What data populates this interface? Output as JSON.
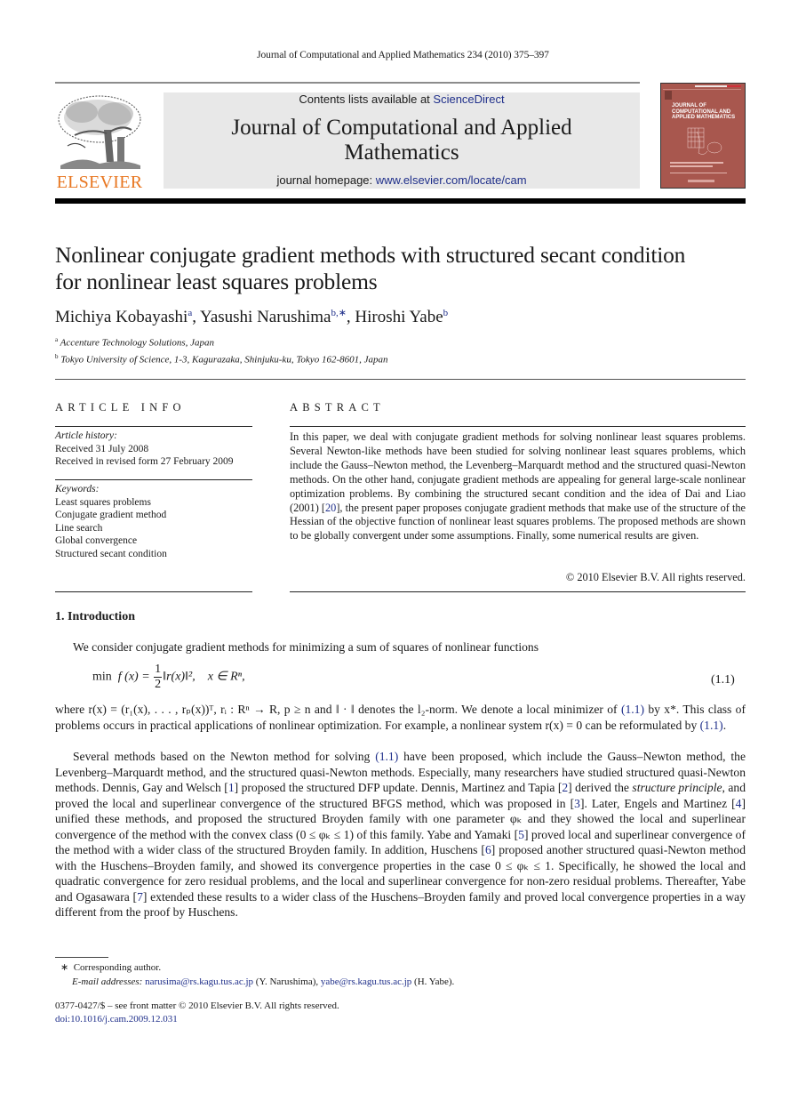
{
  "running_head": "Journal of Computational and Applied Mathematics 234 (2010) 375–397",
  "masthead": {
    "publisher_logo_text": "ELSEVIER",
    "contents_prefix": "Contents lists available at ",
    "contents_link": "ScienceDirect",
    "journal_name_line1": "Journal of Computational and Applied",
    "journal_name_line2": "Mathematics",
    "homepage_prefix": "journal homepage: ",
    "homepage_link": "www.elsevier.com/locate/cam",
    "cover_title_lines": [
      "JOURNAL OF",
      "COMPUTATIONAL AND",
      "APPLIED MATHEMATICS"
    ],
    "colors": {
      "elsevier_orange": "#e87722",
      "cover_red": "#a8574e",
      "link_blue": "#1f2f8a",
      "box_gray": "#e8e8e8"
    }
  },
  "article": {
    "title_line1": "Nonlinear conjugate gradient methods with structured secant condition",
    "title_line2": "for nonlinear least squares problems",
    "authors": [
      {
        "name": "Michiya Kobayashi",
        "mark": "a"
      },
      {
        "name": "Yasushi Narushima",
        "mark": "b,∗"
      },
      {
        "name": "Hiroshi Yabe",
        "mark": "b"
      }
    ],
    "affiliations": [
      {
        "mark": "a",
        "text": "Accenture Technology Solutions, Japan"
      },
      {
        "mark": "b",
        "text": "Tokyo University of Science, 1-3, Kagurazaka, Shinjuku-ku, Tokyo 162-8601, Japan"
      }
    ]
  },
  "article_info": {
    "heading": "ARTICLE INFO",
    "history_label": "Article history:",
    "history": [
      "Received 31 July 2008",
      "Received in revised form 27 February 2009"
    ],
    "keywords_label": "Keywords:",
    "keywords": [
      "Least squares problems",
      "Conjugate gradient method",
      "Line search",
      "Global convergence",
      "Structured secant condition"
    ]
  },
  "abstract": {
    "heading": "ABSTRACT",
    "text_before_ref": "In this paper, we deal with conjugate gradient methods for solving nonlinear least squares problems. Several Newton-like methods have been studied for solving nonlinear least squares problems, which include the Gauss–Newton method, the Levenberg–Marquardt method and the structured quasi-Newton methods. On the other hand, conjugate gradient methods are appealing for general large-scale nonlinear optimization problems. By combining the structured secant condition and the idea of Dai and Liao (2001) [",
    "ref": "20",
    "text_after_ref": "], the present paper proposes conjugate gradient methods that make use of the structure of the Hessian of the objective function of nonlinear least squares problems. The proposed methods are shown to be globally convergent under some assumptions. Finally, some numerical results are given.",
    "copyright": "© 2010 Elsevier B.V. All rights reserved."
  },
  "introduction": {
    "heading": "1.  Introduction",
    "para1": "We consider conjugate gradient methods for minimizing a sum of squares of nonlinear functions",
    "equation": {
      "min": "min",
      "lhs": "f (x) =",
      "frac_num": "1",
      "frac_den": "2",
      "rhs": "‖r(x)‖²,",
      "domain": "x ∈ Rⁿ,",
      "number": "(1.1)"
    },
    "para2": {
      "t1": "where r(x) = (r₁(x), . . . , rₚ(x))ᵀ, rᵢ : Rⁿ → R, p ≥ n and ‖ · ‖ denotes the l₂-norm. We denote a local minimizer of ",
      "ref1": "(1.1)",
      "t2": " by x*. This class of problems occurs in practical applications of nonlinear optimization. For example, a nonlinear system r(x) = 0 can be reformulated by ",
      "ref2": "(1.1)",
      "t3": "."
    },
    "para3": {
      "t1": "Several methods based on the Newton method for solving ",
      "ref_eq": "(1.1)",
      "t2": " have been proposed, which include the Gauss–Newton method, the Levenberg–Marquardt method, and the structured quasi-Newton methods. Especially, many researchers have studied structured quasi-Newton methods. Dennis, Gay and Welsch [",
      "ref1": "1",
      "t3": "] proposed the structured DFP update. Dennis, Martinez and Tapia [",
      "ref2": "2",
      "t4": "] derived the ",
      "italic": "structure principle",
      "t5": ", and proved the local and superlinear convergence of the structured BFGS method, which was proposed in [",
      "ref3": "3",
      "t6": "]. Later, Engels and Martinez [",
      "ref4": "4",
      "t7": "] unified these methods, and proposed the structured Broyden family with one parameter φₖ and they showed the local and superlinear convergence of the method with the convex class (0 ≤ φₖ ≤ 1) of this family. Yabe and Yamaki [",
      "ref5": "5",
      "t8": "] proved local and superlinear convergence of the method with a wider class of the structured Broyden family. In addition, Huschens [",
      "ref6": "6",
      "t9": "] proposed another structured quasi-Newton method with the Huschens–Broyden family, and showed its convergence properties in the case 0 ≤ φₖ ≤ 1. Specifically, he showed the local and quadratic convergence for zero residual problems, and the local and superlinear convergence for non-zero residual problems. Thereafter, Yabe and Ogasawara [",
      "ref7": "7",
      "t10": "] extended these results to a wider class of the Huschens–Broyden family and proved local convergence properties in a way different from the proof by Huschens."
    }
  },
  "footnotes": {
    "corresponding_mark": "∗",
    "corresponding": "Corresponding author.",
    "email_label": "E-mail addresses:",
    "email1": "narusima@rs.kagu.tus.ac.jp",
    "email1_owner": " (Y. Narushima), ",
    "email2": "yabe@rs.kagu.tus.ac.jp",
    "email2_owner": " (H. Yabe).",
    "issn_line": "0377-0427/$ – see front matter © 2010 Elsevier B.V. All rights reserved.",
    "doi": "doi:10.1016/j.cam.2009.12.031"
  }
}
